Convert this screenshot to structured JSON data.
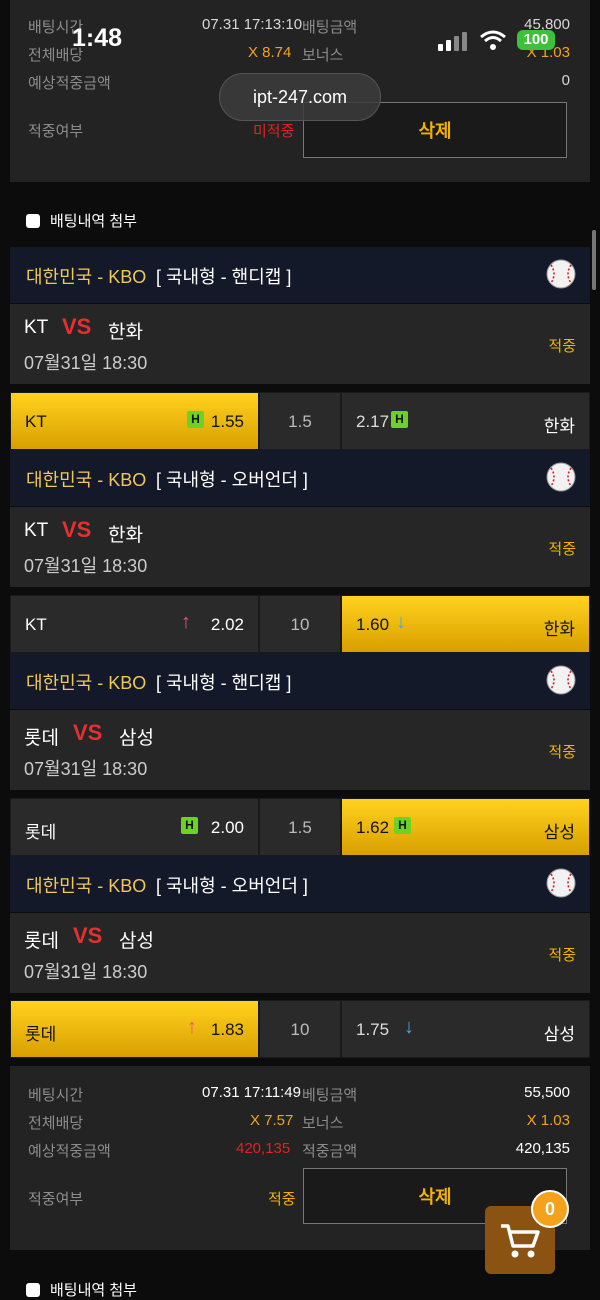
{
  "status_bar": {
    "time": "1:48",
    "battery": "100"
  },
  "browser": {
    "url": "ipt-247.com"
  },
  "slip_top": {
    "rows": [
      {
        "label_left": "배팅시간",
        "value_left": "07.31 17:13:10",
        "label_right": "배팅금액",
        "value_right": "45,800"
      },
      {
        "label_left": "전체배당",
        "value_left": "X 8.74",
        "label_right": "보너스",
        "value_right": "X 1.03"
      },
      {
        "label_left": "예상적중금액",
        "value_left": "",
        "label_right": "",
        "value_right": "0"
      }
    ],
    "result_label": "적중여부",
    "result_value": "미적중",
    "delete_label": "삭제",
    "attach_label": "배팅내역 첨부"
  },
  "bets": [
    {
      "league": "대한민국 - KBO",
      "market": "[ 국내형 - 핸디캡 ]",
      "home": "KT",
      "vs": "VS",
      "away": "한화",
      "datetime": "07월31일 18:30",
      "status": "적중",
      "home_odds": "1.55",
      "line": "1.5",
      "away_odds": "2.17",
      "home_badge": "H",
      "away_badge": "H",
      "selected": "home"
    },
    {
      "league": "대한민국 - KBO",
      "market": "[ 국내형 - 오버언더 ]",
      "home": "KT",
      "vs": "VS",
      "away": "한화",
      "datetime": "07월31일 18:30",
      "status": "적중",
      "home_odds": "2.02",
      "line": "10",
      "away_odds": "1.60",
      "home_arrow": "↑",
      "away_arrow": "↓",
      "selected": "away"
    },
    {
      "league": "대한민국 - KBO",
      "market": "[ 국내형 - 핸디캡 ]",
      "home": "롯데",
      "vs": "VS",
      "away": "삼성",
      "datetime": "07월31일 18:30",
      "status": "적중",
      "home_odds": "2.00",
      "line": "1.5",
      "away_odds": "1.62",
      "home_badge": "H",
      "away_badge": "H",
      "selected": "away"
    },
    {
      "league": "대한민국 - KBO",
      "market": "[ 국내형 - 오버언더 ]",
      "home": "롯데",
      "vs": "VS",
      "away": "삼성",
      "datetime": "07월31일 18:30",
      "status": "적중",
      "home_odds": "1.83",
      "line": "10",
      "away_odds": "1.75",
      "home_arrow": "↑",
      "away_arrow": "↓",
      "selected": "home"
    }
  ],
  "summary": {
    "bet_time_label": "베팅시간",
    "bet_time": "07.31 17:11:49",
    "bet_amount_label": "베팅금액",
    "bet_amount": "55,500",
    "total_odds_label": "전체배당",
    "total_odds": "X 7.57",
    "bonus_label": "보너스",
    "bonus": "X 1.03",
    "expected_label": "예상적중금액",
    "expected": "420,135",
    "hit_amount_label": "적중금액",
    "hit_amount": "420,135",
    "result_label": "적중여부",
    "result_value": "적중",
    "delete_label": "삭제",
    "attach_label": "배팅내역 첨부"
  },
  "cart": {
    "count": "0"
  },
  "colors": {
    "accent": "#f4b100",
    "selected_gradient_top": "#ffd21f",
    "league_bg": "#14192a",
    "vs_red": "#e53030"
  }
}
